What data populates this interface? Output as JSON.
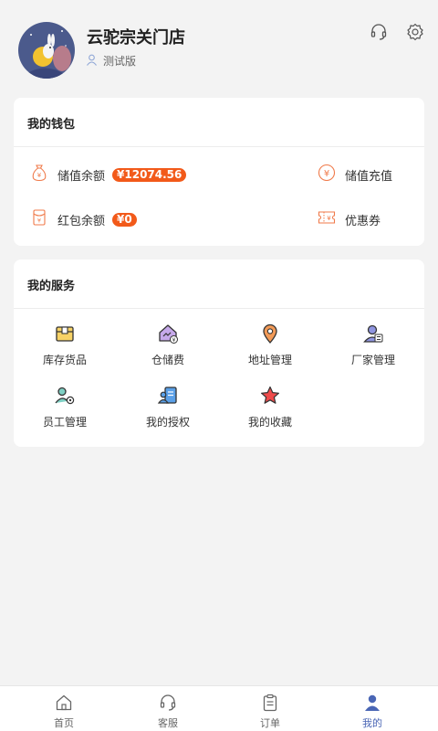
{
  "profile": {
    "store_name": "云驼宗关门店",
    "version_label": "测试版"
  },
  "header_actions": {
    "support_icon": "headset-icon",
    "settings_icon": "gear-icon"
  },
  "wallet": {
    "title": "我的钱包",
    "stored_value_label": "储值余额",
    "stored_value_amount": "¥12074.56",
    "recharge_label": "储值充值",
    "red_packet_label": "红包余额",
    "red_packet_amount": "¥0",
    "coupon_label": "优惠券"
  },
  "services": {
    "title": "我的服务",
    "items": [
      {
        "label": "库存货品",
        "icon": "box-icon"
      },
      {
        "label": "仓储费",
        "icon": "warehouse-fee-icon"
      },
      {
        "label": "地址管理",
        "icon": "location-pin-icon"
      },
      {
        "label": "厂家管理",
        "icon": "manufacturer-icon"
      },
      {
        "label": "员工管理",
        "icon": "staff-icon"
      },
      {
        "label": "我的授权",
        "icon": "authorization-icon"
      },
      {
        "label": "我的收藏",
        "icon": "star-icon"
      }
    ]
  },
  "tabbar": {
    "items": [
      {
        "label": "首页",
        "icon": "home-icon"
      },
      {
        "label": "客服",
        "icon": "headset-icon"
      },
      {
        "label": "订单",
        "icon": "clipboard-icon"
      },
      {
        "label": "我的",
        "icon": "person-icon"
      }
    ],
    "active_index": 3
  },
  "colors": {
    "accent_orange": "#f25a1a",
    "active_tab": "#4a66b5",
    "background": "#f3f3f3"
  }
}
